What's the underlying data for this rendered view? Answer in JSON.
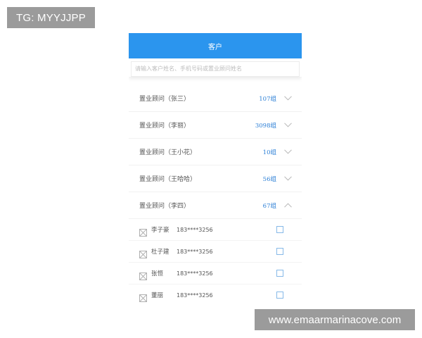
{
  "watermarks": {
    "top_left": "TG: MYYJJPP",
    "bottom_right": "www.emaarmarinacove.com"
  },
  "header": {
    "title": "客户"
  },
  "search": {
    "placeholder": "请输入客户姓名、手机号码或置业顾问姓名"
  },
  "groups": [
    {
      "title": "置业顾问（张三）",
      "count": "107组",
      "expanded": false
    },
    {
      "title": "置业顾问（李丽）",
      "count": "3098组",
      "expanded": false
    },
    {
      "title": "置业顾问（王小花）",
      "count": "10组",
      "expanded": false
    },
    {
      "title": "置业顾问（王哈哈）",
      "count": "56组",
      "expanded": false
    },
    {
      "title": "置业顾问（李四）",
      "count": "67组",
      "expanded": true,
      "members": [
        {
          "name": "李子豪",
          "phone": "183****3256"
        },
        {
          "name": "杜子建",
          "phone": "183****3256"
        },
        {
          "name": "张恒",
          "phone": "183****3256"
        },
        {
          "name": "董丽",
          "phone": "183****3256"
        }
      ]
    }
  ],
  "colors": {
    "accent": "#2b95ee",
    "count_text": "#2b7fd6",
    "checkbox_border": "#86b9e8",
    "chevron": "#b5b5b5"
  },
  "icons": {
    "collapsed": "chevron-down-icon",
    "expanded": "chevron-up-icon",
    "avatar": "image-placeholder-icon"
  }
}
